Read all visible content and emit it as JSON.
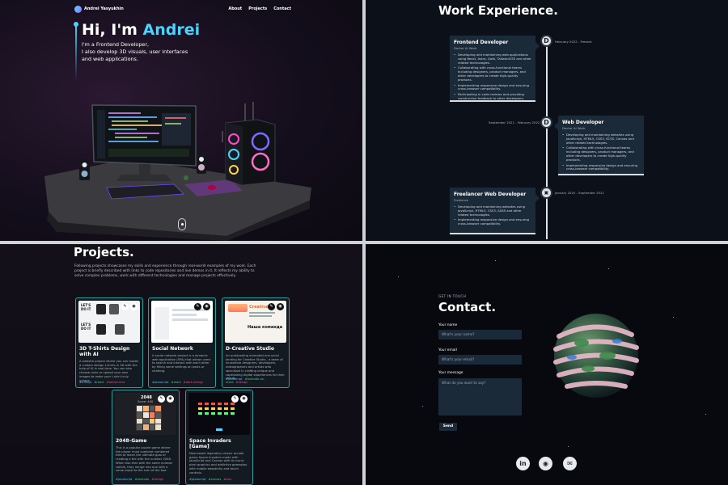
{
  "nav": {
    "brand": "Andrei Yasyukhin",
    "links": [
      "About",
      "Projects",
      "Contact"
    ]
  },
  "hero": {
    "greeting": "Hi, I'm ",
    "name": "Andrei",
    "line1": "I'm a Frontend Developer,",
    "line2": "I also develop 3D visuals, user interfaces",
    "line3": "and web applications."
  },
  "experience": {
    "title": "Work Experience.",
    "items": [
      {
        "role": "Frontend Developer",
        "company": "Doctor AI Work",
        "date": "February 2022 - Present",
        "node": "D",
        "points": [
          "Developing and maintaining web applications using React, Astro, Qwik, TailwindCSS and other related technologies.",
          "Collaborating with cross-functional teams including designers, product managers, and other developers to create high-quality products.",
          "Implementing responsive design and ensuring cross-browser compatibility.",
          "Participating in code reviews and providing constructive feedback to other developers."
        ]
      },
      {
        "role": "Web Developer",
        "company": "Doctor AI Work",
        "date": "September 2021 - February 2022",
        "node": "D",
        "points": [
          "Developing and maintaining websites using JavaScript, HTML5, CSS3, SCSS, Canvas and other related technologies.",
          "Collaborating with cross-functional teams including designers, product managers, and other developers to create high-quality products.",
          "Implementing responsive design and ensuring cross-browser compatibility."
        ]
      },
      {
        "role": "Freelancer Web Developer",
        "company": "Freelance",
        "date": "January 2020 - September 2021",
        "node": "▣",
        "points": [
          "Developing and maintaining websites using JavaScript, HTML5, CSS3, SASS and other related technologies.",
          "Implementing responsive design and ensuring cross-browser compatibility."
        ]
      }
    ]
  },
  "projects": {
    "title": "Projects.",
    "intro": "Following projects showcases my skills and experience through real-world examples of my work. Each project is briefly described with links to code repositories and live demos in it. It reflects my ability to solve complex problems, work with different technologies and manage projects effectively.",
    "items": [
      {
        "title": "3D T-Shirts Design with AI",
        "desc": "A website project where you can model a custom design t-shirts in 3D with the help of AI in real-time. You can also choose color or upload your own images to make your t-shirt truly unique.",
        "tags": [
          "#threejs",
          "#react",
          "#tailwindcss"
        ],
        "tag_colors": [
          "#4fc3f7",
          "#4dd08a",
          "#e94a8c"
        ]
      },
      {
        "title": "Social Network",
        "desc": "A social network project is a dynamic web application (SPA) that allows users to search and interact with each other by filling some settings on posts or chatting.",
        "tags": [
          "#javascript",
          "#react",
          "#dark-design"
        ],
        "tag_colors": [
          "#4fc3f7",
          "#4dd08a",
          "#e94a8c"
        ]
      },
      {
        "title": "D-Creative Studio",
        "desc": "An outstanding animated one-scroll landing for Creative Studio - a team of innovative designers, developers, videographers and artists who specialize in crafting unique and captivating digital experiences for their clients.",
        "tags": [
          "#javascript",
          "#animate-on-scroll",
          "#design"
        ],
        "tag_colors": [
          "#4fc3f7",
          "#4dd08a",
          "#e94a8c"
        ]
      },
      {
        "title": "2048-Game",
        "desc": "This is a popular puzzle game where the player must combine numbered tiles to reach the ultimate goal of creating a tile with the number 2048. When two tiles with the same number collide, they merge into one with a value equal to the sum of the two.",
        "tags": [
          "#javascript",
          "#animate",
          "#design"
        ],
        "tag_colors": [
          "#4fc3f7",
          "#4dd08a",
          "#e94a8c"
        ]
      },
      {
        "title": "Space Invaders [Game]",
        "desc": "Now-based legendary classic arcade game Space Invaders made with JavaScript and Canvas with its iconic pixel graphics and addictive gameplay with mobile adaptivity and touch controls.",
        "tags": [
          "#javascript",
          "#canvas",
          "#oop"
        ],
        "tag_colors": [
          "#4fc3f7",
          "#4dd08a",
          "#e94a8c"
        ]
      }
    ],
    "thumb_texts": {
      "tshirt_top": "LET'S DO IT",
      "tshirt_bottom": "LET'S DO IT",
      "creative_brand": "Creative",
      "creative_name": "Наша команда",
      "game_title": "2048",
      "game_score": "Score: 440"
    }
  },
  "contact": {
    "eyebrow": "GET IN TOUCH",
    "title": "Contact.",
    "name_label": "Your name",
    "name_placeholder": "What's your name?",
    "email_label": "Your email",
    "email_placeholder": "What's your email?",
    "message_label": "Your message",
    "message_placeholder": "What do you want to say?",
    "send": "Send",
    "socials": [
      {
        "icon": "linkedin-icon",
        "glyph": "in"
      },
      {
        "icon": "github-icon",
        "glyph": "◉"
      },
      {
        "icon": "email-icon",
        "glyph": "✉"
      }
    ]
  },
  "colors": {
    "accent": "#4ad3ff",
    "card_bg": "#1b2a38",
    "project_border": "#2c9f9a"
  }
}
